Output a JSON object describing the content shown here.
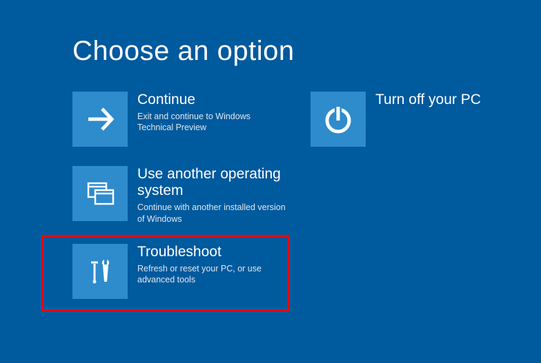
{
  "title": "Choose an option",
  "options": {
    "continue": {
      "title": "Continue",
      "desc": "Exit and continue to Windows Technical Preview"
    },
    "another_os": {
      "title": "Use another operating system",
      "desc": "Continue with another installed version of Windows"
    },
    "troubleshoot": {
      "title": "Troubleshoot",
      "desc": "Refresh or reset your PC, or use advanced tools"
    },
    "poweroff": {
      "title": "Turn off your PC"
    }
  },
  "colors": {
    "background": "#005a9e",
    "tile": "#2e8bcc",
    "highlight": "#ff0000"
  }
}
